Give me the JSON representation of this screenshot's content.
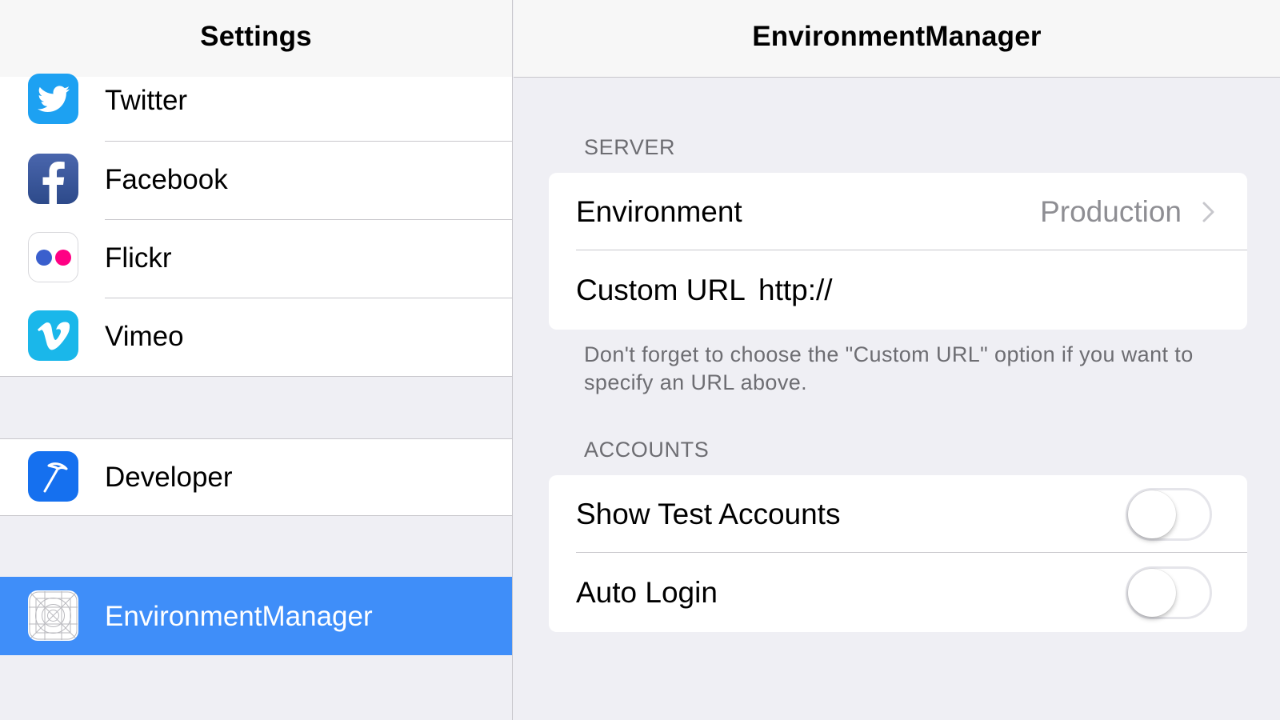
{
  "master": {
    "title": "Settings",
    "groups": [
      {
        "items": [
          {
            "label": "Twitter",
            "icon": "twitter-icon"
          },
          {
            "label": "Facebook",
            "icon": "facebook-icon"
          },
          {
            "label": "Flickr",
            "icon": "flickr-icon"
          },
          {
            "label": "Vimeo",
            "icon": "vimeo-icon"
          }
        ]
      },
      {
        "items": [
          {
            "label": "Developer",
            "icon": "hammer-icon"
          }
        ]
      },
      {
        "items": [
          {
            "label": "EnvironmentManager",
            "icon": "app-placeholder-icon",
            "selected": true
          }
        ]
      }
    ]
  },
  "detail": {
    "title": "EnvironmentManager",
    "server": {
      "header": "SERVER",
      "environment_label": "Environment",
      "environment_value": "Production",
      "custom_url_label": "Custom URL",
      "custom_url_value": "http://",
      "footer": "Don't forget to choose the \"Custom URL\" option if you want to specify an URL above."
    },
    "accounts": {
      "header": "ACCOUNTS",
      "show_test_accounts_label": "Show Test Accounts",
      "show_test_accounts_on": false,
      "auto_login_label": "Auto Login",
      "auto_login_on": false
    }
  },
  "colors": {
    "selection": "#3f8ef9",
    "twitter": "#1da1f2",
    "facebook": "#3b5998",
    "flickr_blue": "#0063dc",
    "flickr_pink": "#ff0084",
    "vimeo": "#1ab7ea",
    "developer": "#1570ef",
    "secondary_text": "#8e8e93",
    "background": "#efeff4"
  }
}
